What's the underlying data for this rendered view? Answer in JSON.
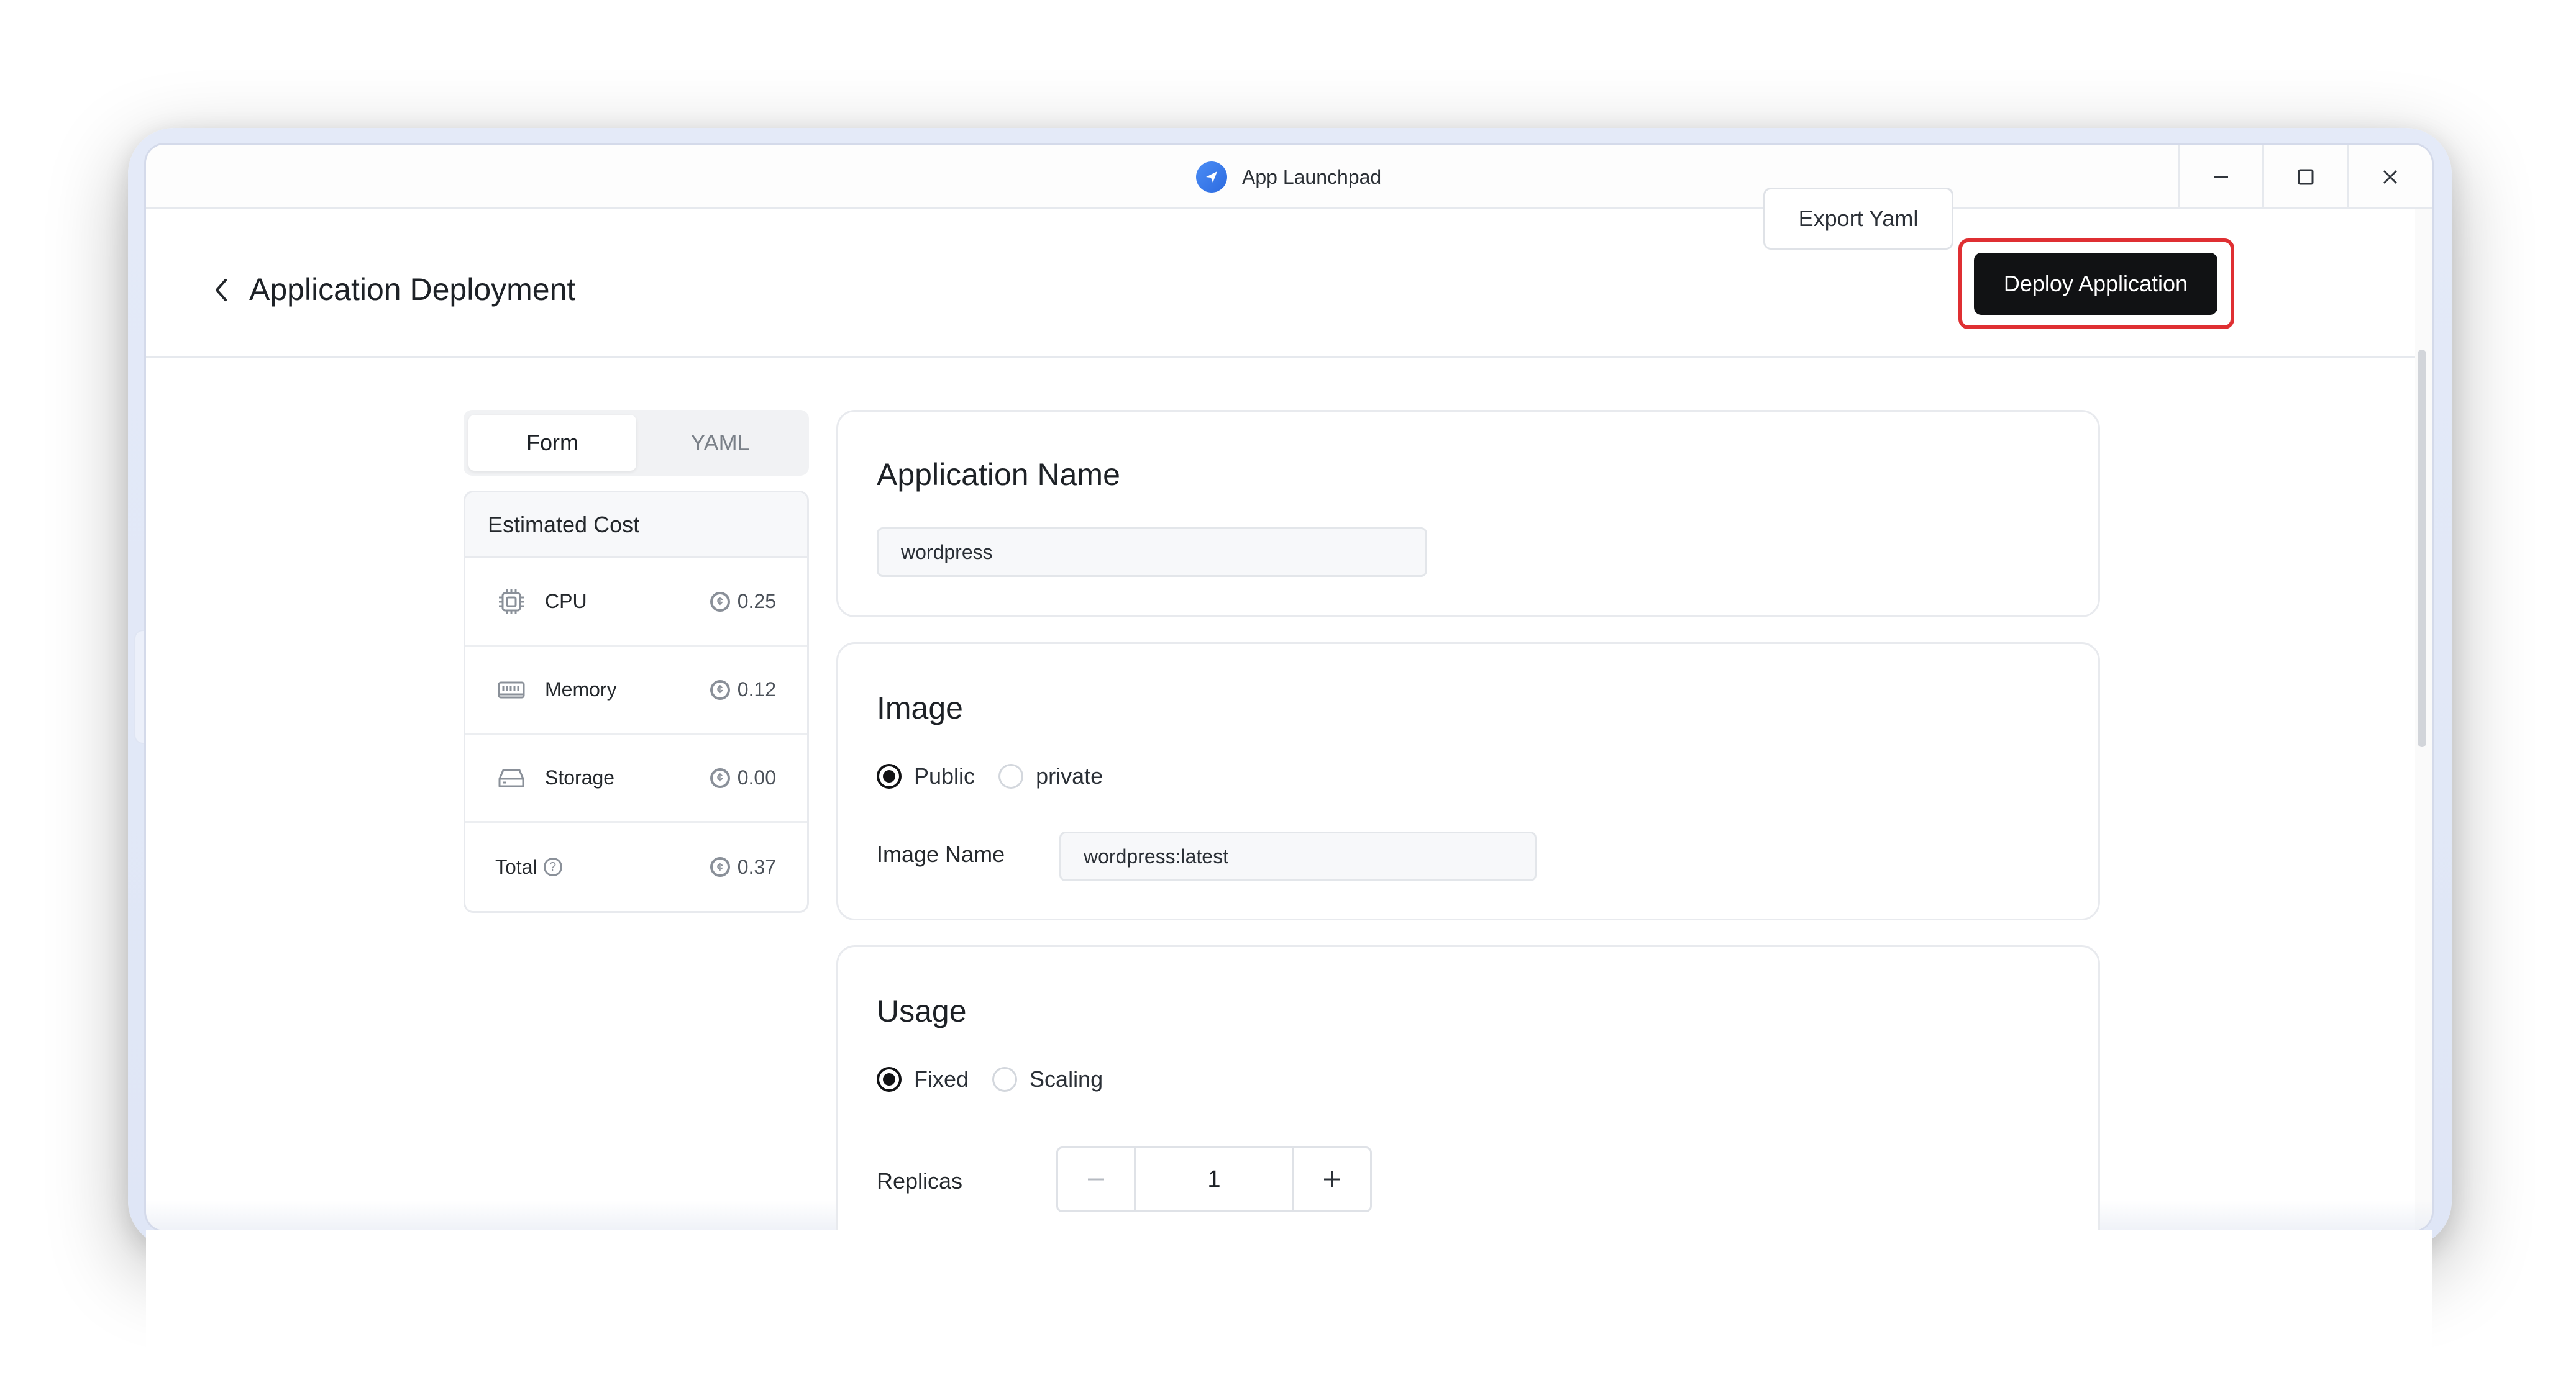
{
  "window": {
    "app_title": "App Launchpad",
    "app_icon": "rocket-icon",
    "controls": [
      "minimize-icon",
      "maximize-icon",
      "close-icon"
    ]
  },
  "header": {
    "title": "Application Deployment",
    "export_label": "Export Yaml",
    "deploy_label": "Deploy Application",
    "highlight_color": "#df2f32"
  },
  "tabs": [
    {
      "label": "Form",
      "active": true
    },
    {
      "label": "YAML",
      "active": false
    }
  ],
  "cost": {
    "title": "Estimated Cost",
    "rows": [
      {
        "label": "CPU",
        "icon": "cpu-icon",
        "value": "0.25"
      },
      {
        "label": "Memory",
        "icon": "memory-icon",
        "value": "0.12"
      },
      {
        "label": "Storage",
        "icon": "storage-icon",
        "value": "0.00"
      }
    ],
    "total": {
      "label": "Total",
      "value": "0.37"
    }
  },
  "app_name": {
    "title": "Application Name",
    "value": "wordpress"
  },
  "image": {
    "title": "Image",
    "options": [
      {
        "label": "Public",
        "selected": true
      },
      {
        "label": "private",
        "selected": false
      }
    ],
    "name_label": "Image Name",
    "name_value": "wordpress:latest"
  },
  "usage": {
    "title": "Usage",
    "options": [
      {
        "label": "Fixed",
        "selected": true
      },
      {
        "label": "Scaling",
        "selected": false
      }
    ],
    "replicas_label": "Replicas",
    "replicas_value": "1"
  }
}
